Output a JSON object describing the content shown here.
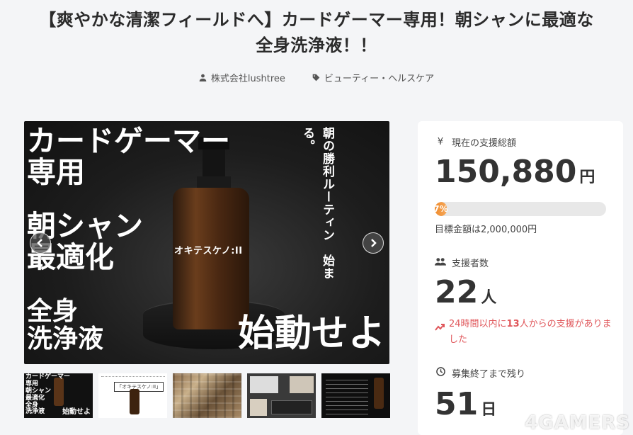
{
  "project": {
    "title_line1": "【爽やかな清潔フィールドへ】カードゲーマー専用！朝シャンに最適な",
    "title_line2": "全身洗浄液！！",
    "owner": "株式会社lushtree",
    "category": "ビューティー・ヘルスケア"
  },
  "hero": {
    "text_top": "カードゲーマー\n専用",
    "text_mid": "朝シャン\n最適化",
    "text_low": "全身\n洗浄液",
    "text_right": "始動せよ",
    "vertical_text": "朝の勝利ルーティン　始まる。",
    "bottle_label": "オキテスケノ:II"
  },
  "thumbnails": [
    {
      "top": "カードゲーマー\n専用\n朝シャン\n最適化\n全身\n洗浄液",
      "corner": "始動せよ"
    },
    {
      "caption": "「オキテスケノ:II」"
    },
    {},
    {},
    {}
  ],
  "panel": {
    "amount_label": "現在の支援総額",
    "amount_value": "150,880",
    "amount_unit": "円",
    "progress_percent": 7,
    "progress_text": "7%",
    "goal_text": "目標金額は2,000,000円",
    "supporters_label": "支援者数",
    "supporters_value": "22",
    "supporters_unit": "人",
    "trend_prefix": "24時間以内に",
    "trend_count": "13",
    "trend_suffix": "人からの支援がありました",
    "remaining_label": "募集終了まで残り",
    "remaining_value": "51",
    "remaining_unit": "日"
  },
  "icons": {
    "owner": "user-icon",
    "category": "tag-icon",
    "amount": "yen-icon",
    "supporters": "users-icon",
    "trend": "trend-up-icon",
    "clock": "clock-icon"
  },
  "watermark": "4GAMERS",
  "colors": {
    "accent": "#f08b2c",
    "trend": "#e0575b"
  }
}
